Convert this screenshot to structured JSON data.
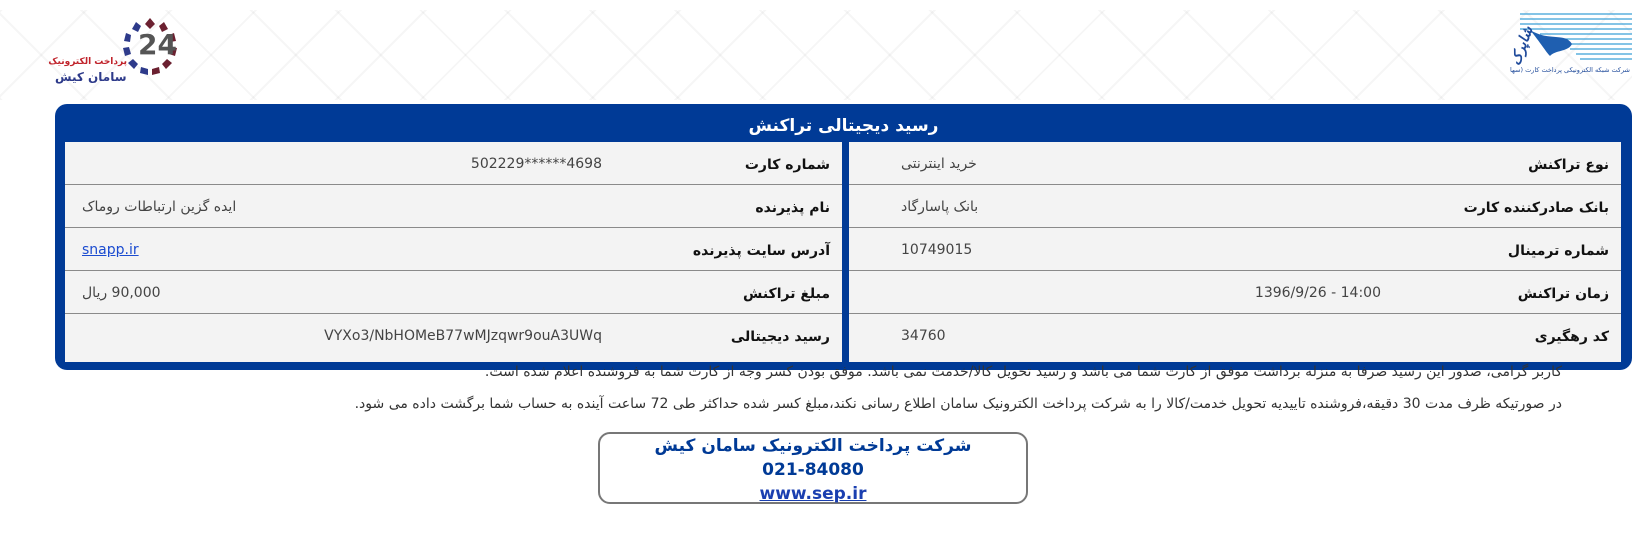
{
  "logos": {
    "left_brand_line1": "پرداخت الکترونیک",
    "left_brand_line2": "سامان کیش",
    "left_emblem_text": "24",
    "right_brand": "شاپرک",
    "right_subtitle": "شرکت شبکه الکترونیکی پرداخت کارت (سهامی خاص)"
  },
  "receipt": {
    "title": "رسید دیجیتالی تراکنش",
    "right_column": [
      {
        "label": "نوع تراکنش",
        "value": "خرید اینترنتی"
      },
      {
        "label": "بانک صادرکننده کارت",
        "value": "بانک پاسارگاد"
      },
      {
        "label": "شماره ترمینال",
        "value": "10749015"
      },
      {
        "label": "زمان تراکنش",
        "value": "1396/9/26 - 14:00"
      },
      {
        "label": "کد رهگیری",
        "value": "34760"
      }
    ],
    "left_column": [
      {
        "label": "شماره کارت",
        "value": "502229******4698"
      },
      {
        "label": "نام پذیرنده",
        "value": "ایده گزین ارتباطات روماک"
      },
      {
        "label": "آدرس سایت پذیرنده",
        "value": "snapp.ir"
      },
      {
        "label": "مبلغ تراکنش",
        "value": "90,000 ریال"
      },
      {
        "label": "رسید دیجیتالی",
        "value": "VYXo3/NbHOMeB77wMJzqwr9ouA3UWq"
      }
    ]
  },
  "notices": {
    "line1": "کاربر گرامی، صدور این رسید صرفا به منزله برداشت موفق از کارت شما می باشد و رسید تحویل کالا/خدمت نمی باشد. موفق بودن کسر وجه از کارت شما به فروشنده اعلام شده است.",
    "line2": "در صورتیکه ظرف مدت 30 دقیقه،فروشنده تاییدیه تحویل خدمت/کالا را به شرکت پرداخت الکترونیک سامان اطلاع رسانی نکند،مبلغ کسر شده حداکثر طی 72 ساعت آینده به حساب شما برگشت داده می شود."
  },
  "contact": {
    "company": "شرکت پرداخت الکترونیک سامان کیش",
    "phone": "021-84080",
    "website": "www.sep.ir"
  },
  "colors": {
    "primary": "#003a96",
    "row_bg": "#f3f3f3",
    "link": "#1a4bd0"
  }
}
